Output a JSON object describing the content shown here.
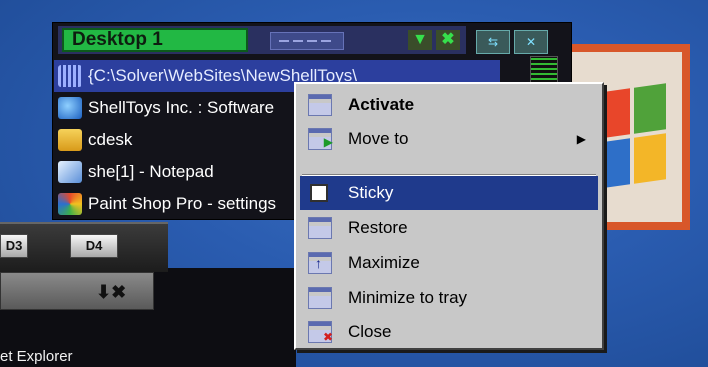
{
  "desktop_manager": {
    "desktop_name": "Desktop 1",
    "tasks": [
      {
        "label": "{C:\\Solver\\WebSites\\NewShellToys\\",
        "icon": "folder-grid-icon",
        "selected": true
      },
      {
        "label": "ShellToys Inc. : Software",
        "icon": "browser-icon",
        "selected": false
      },
      {
        "label": "cdesk",
        "icon": "folder-icon",
        "selected": false
      },
      {
        "label": "she[1] - Notepad",
        "icon": "notepad-icon",
        "selected": false
      },
      {
        "label": "Paint Shop Pro - settings",
        "icon": "paint-icon",
        "selected": false
      }
    ]
  },
  "pager": {
    "tabs": [
      "D3",
      "D4"
    ],
    "strip_icons": "⬇✖",
    "taskbar_text": "et Explorer"
  },
  "context_menu": {
    "items": [
      {
        "label": "Activate",
        "icon": "activate-icon",
        "bold": true
      },
      {
        "label": "Move to",
        "icon": "move-icon",
        "submenu": true
      },
      {
        "label": "Sticky",
        "icon": "checkbox-icon",
        "highlighted": true
      },
      {
        "label": "Restore",
        "icon": "restore-icon"
      },
      {
        "label": "Maximize",
        "icon": "maximize-icon"
      },
      {
        "label": "Minimize to tray",
        "icon": "minimize-tray-icon"
      },
      {
        "label": "Close",
        "icon": "close-icon"
      }
    ],
    "submenu_arrow": "▶"
  },
  "colors": {
    "desktop": "#2557a6",
    "title_green": "#22b844",
    "selection": "#1f3a8c"
  }
}
